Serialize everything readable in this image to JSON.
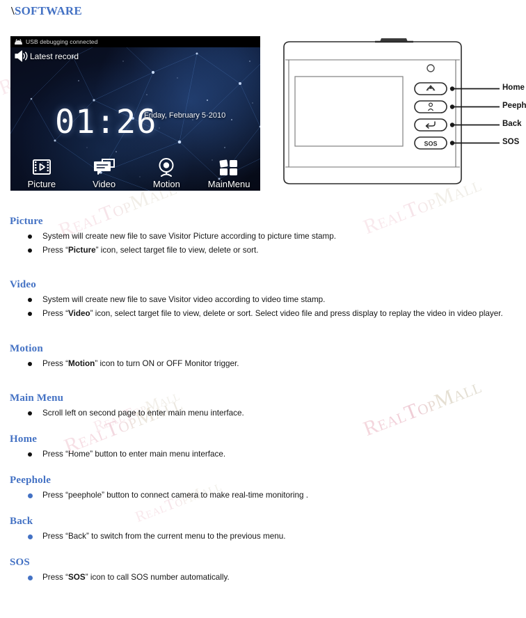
{
  "page": {
    "title_prefix": "\\",
    "title": "SOFTWARE",
    "watermark_text": "RealTopMall"
  },
  "device_screen": {
    "statusbar": {
      "icon": "android-robot-icon",
      "text": "USB debugging connected"
    },
    "notification": {
      "icon": "speaker-icon",
      "text": "Latest record"
    },
    "clock": "01:26",
    "date": "Friday, February 5·2010",
    "dock": [
      {
        "icon": "film-strip-play-icon",
        "label": "Picture"
      },
      {
        "icon": "speech-bubbles-icon",
        "label": "Video"
      },
      {
        "icon": "webcam-eye-icon",
        "label": "Motion"
      },
      {
        "icon": "grid-squares-icon",
        "label": "MainMenu"
      }
    ]
  },
  "device_diagram": {
    "callouts": [
      {
        "button_icon": "home-house-icon",
        "label": "Home"
      },
      {
        "button_icon": "peephole-person-icon",
        "label": "Peephole"
      },
      {
        "button_icon": "back-arrow-icon",
        "label": "Back"
      },
      {
        "button_icon": "sos-text-icon",
        "label": "SOS"
      }
    ],
    "sos_button_text": "SOS"
  },
  "sections": [
    {
      "heading": "Picture",
      "bullet_color": "black",
      "items": [
        {
          "parts": [
            {
              "t": "System will create new file to save Visitor Picture according to picture time stamp."
            }
          ]
        },
        {
          "parts": [
            {
              "t": "Press  “"
            },
            {
              "t": "Picture",
              "b": true
            },
            {
              "t": "”  icon, select target file to view, delete or sort."
            }
          ]
        }
      ]
    },
    {
      "heading": "Video",
      "bullet_color": "black",
      "items": [
        {
          "parts": [
            {
              "t": "System will create new file to save Visitor video according to video time stamp."
            }
          ]
        },
        {
          "parts": [
            {
              "t": "Press  “"
            },
            {
              "t": "Video",
              "b": true
            },
            {
              "t": "”  icon, select target file to view, delete or sort. Select video file and press display to replay the video in video player."
            }
          ]
        }
      ]
    },
    {
      "heading": "Motion",
      "bullet_color": "black",
      "items": [
        {
          "parts": [
            {
              "t": "Press  “"
            },
            {
              "t": "Motion",
              "b": true
            },
            {
              "t": "”  icon to turn ON or OFF Monitor trigger."
            }
          ]
        }
      ]
    },
    {
      "heading": "Main Menu",
      "bullet_color": "black",
      "items": [
        {
          "parts": [
            {
              "t": "Scroll left on second page to enter main menu interface."
            }
          ]
        }
      ]
    },
    {
      "heading": "Home",
      "bullet_color": "black",
      "items": [
        {
          "parts": [
            {
              "t": "Press “Home” button to enter main menu interface."
            }
          ]
        }
      ]
    },
    {
      "heading": "Peephole",
      "bullet_color": "blue",
      "items": [
        {
          "parts": [
            {
              "t": "Press “peephole” button to connect camera to make real-time monitoring ."
            }
          ]
        }
      ]
    },
    {
      "heading": "Back",
      "bullet_color": "blue",
      "items": [
        {
          "parts": [
            {
              "t": "Press “Back” to switch from the current menu to the previous menu."
            }
          ]
        }
      ]
    },
    {
      "heading": "SOS",
      "bullet_color": "blue",
      "items": [
        {
          "parts": [
            {
              "t": "Press  “"
            },
            {
              "t": "SOS",
              "b": true
            },
            {
              "t": "”  icon to call SOS number automatically."
            }
          ]
        }
      ]
    }
  ],
  "colors": {
    "heading": "#4472c4",
    "bullet_blue": "#4472c4",
    "bullet_black": "#111111",
    "watermark": "#eebfcb"
  }
}
